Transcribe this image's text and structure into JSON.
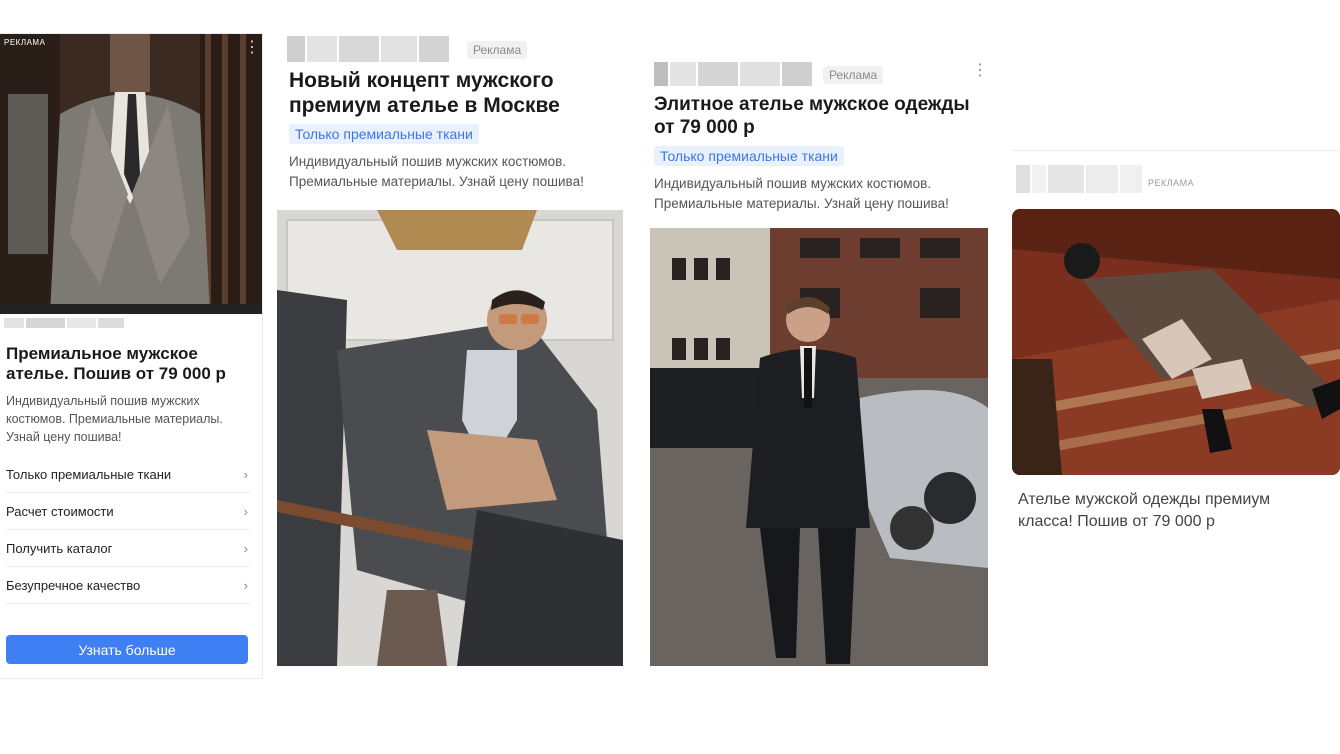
{
  "ads": [
    {
      "ad_label": "РЕКЛАМА",
      "title": "Премиальное мужское ателье. Пошив от 79 000 р",
      "description": "Индивидуальный пошив мужских костюмов. Премиальные материалы. Узнай цену пошива!",
      "links": [
        {
          "label": "Только премиальные ткани",
          "icon": "chevron-right-icon"
        },
        {
          "label": "Расчет стоимости",
          "icon": "chevron-right-icon"
        },
        {
          "label": "Получить каталог",
          "icon": "chevron-right-icon"
        },
        {
          "label": "Безупречное качество",
          "icon": "chevron-right-icon"
        }
      ],
      "button_label": "Узнать больше"
    },
    {
      "ad_label": "Реклама",
      "title": "Новый концепт мужского премиум ателье в Москве",
      "tag": "Только премиальные ткани",
      "description": "Индивидуальный пошив мужских костюмов. Премиальные материалы. Узнай цену пошива!"
    },
    {
      "ad_label": "Реклама",
      "title": "Элитное ателье мужское одежды от 79 000 р",
      "tag": "Только премиальные ткани",
      "description": "Индивидуальный пошив мужских костюмов. Премиальные материалы. Узнай цену пошива!"
    },
    {
      "ad_label": "РЕКЛАМА",
      "title": "Ателье мужской одежды премиум класса! Пошив от 79 000 р"
    }
  ],
  "icons": {
    "more": "kebab-menu-icon",
    "chevron": "chevron-right-icon"
  },
  "colors": {
    "accent": "#3f7ff4",
    "tag_bg": "#e9f1ff",
    "tag_text": "#3b77e6"
  }
}
